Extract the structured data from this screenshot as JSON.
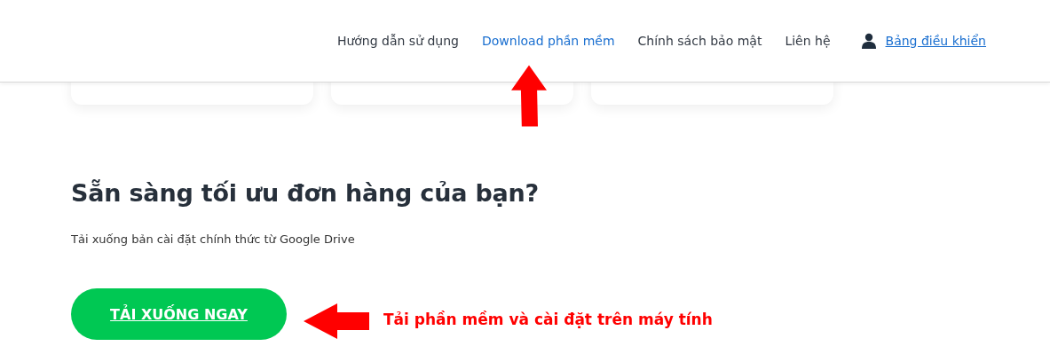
{
  "nav": {
    "items": [
      {
        "label": "Hướng dẫn sử dụng",
        "selected": false
      },
      {
        "label": "Download phần mềm",
        "selected": true
      },
      {
        "label": "Chính sách bảo mật",
        "selected": false
      },
      {
        "label": "Liên hệ",
        "selected": false
      }
    ],
    "account_link": "Bảng điều khiển"
  },
  "cards": [
    {
      "kind": "card"
    },
    {
      "kind": "card"
    },
    {
      "kind": "card"
    }
  ],
  "cta": {
    "heading": "Sẵn sàng tối ưu đơn hàng của bạn?",
    "description": "Tải xuống bản cài đặt chính thức từ Google Drive",
    "button": "TẢI XUỐNG NGAY"
  },
  "annotation": {
    "note": "Tải phần mềm và cài đặt trên máy tính"
  }
}
